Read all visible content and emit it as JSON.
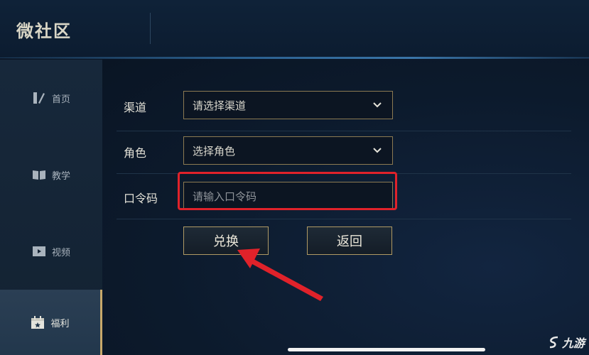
{
  "header": {
    "title": "微社区"
  },
  "sidebar": {
    "items": [
      {
        "label": "首页",
        "icon": "pen-icon"
      },
      {
        "label": "教学",
        "icon": "book-icon"
      },
      {
        "label": "视频",
        "icon": "video-play-icon"
      },
      {
        "label": "福利",
        "icon": "gift-calendar-icon",
        "active": true
      }
    ]
  },
  "form": {
    "channel": {
      "label": "渠道",
      "value": "请选择渠道"
    },
    "role": {
      "label": "角色",
      "value": "选择角色"
    },
    "code": {
      "label": "口令码",
      "placeholder": "请输入口令码"
    },
    "redeem_button": "兑换",
    "back_button": "返回"
  },
  "watermark": {
    "text": "九游"
  },
  "colors": {
    "accent_gold": "#b09a64",
    "highlight_red": "#e0222a",
    "background": "#0b1626"
  }
}
